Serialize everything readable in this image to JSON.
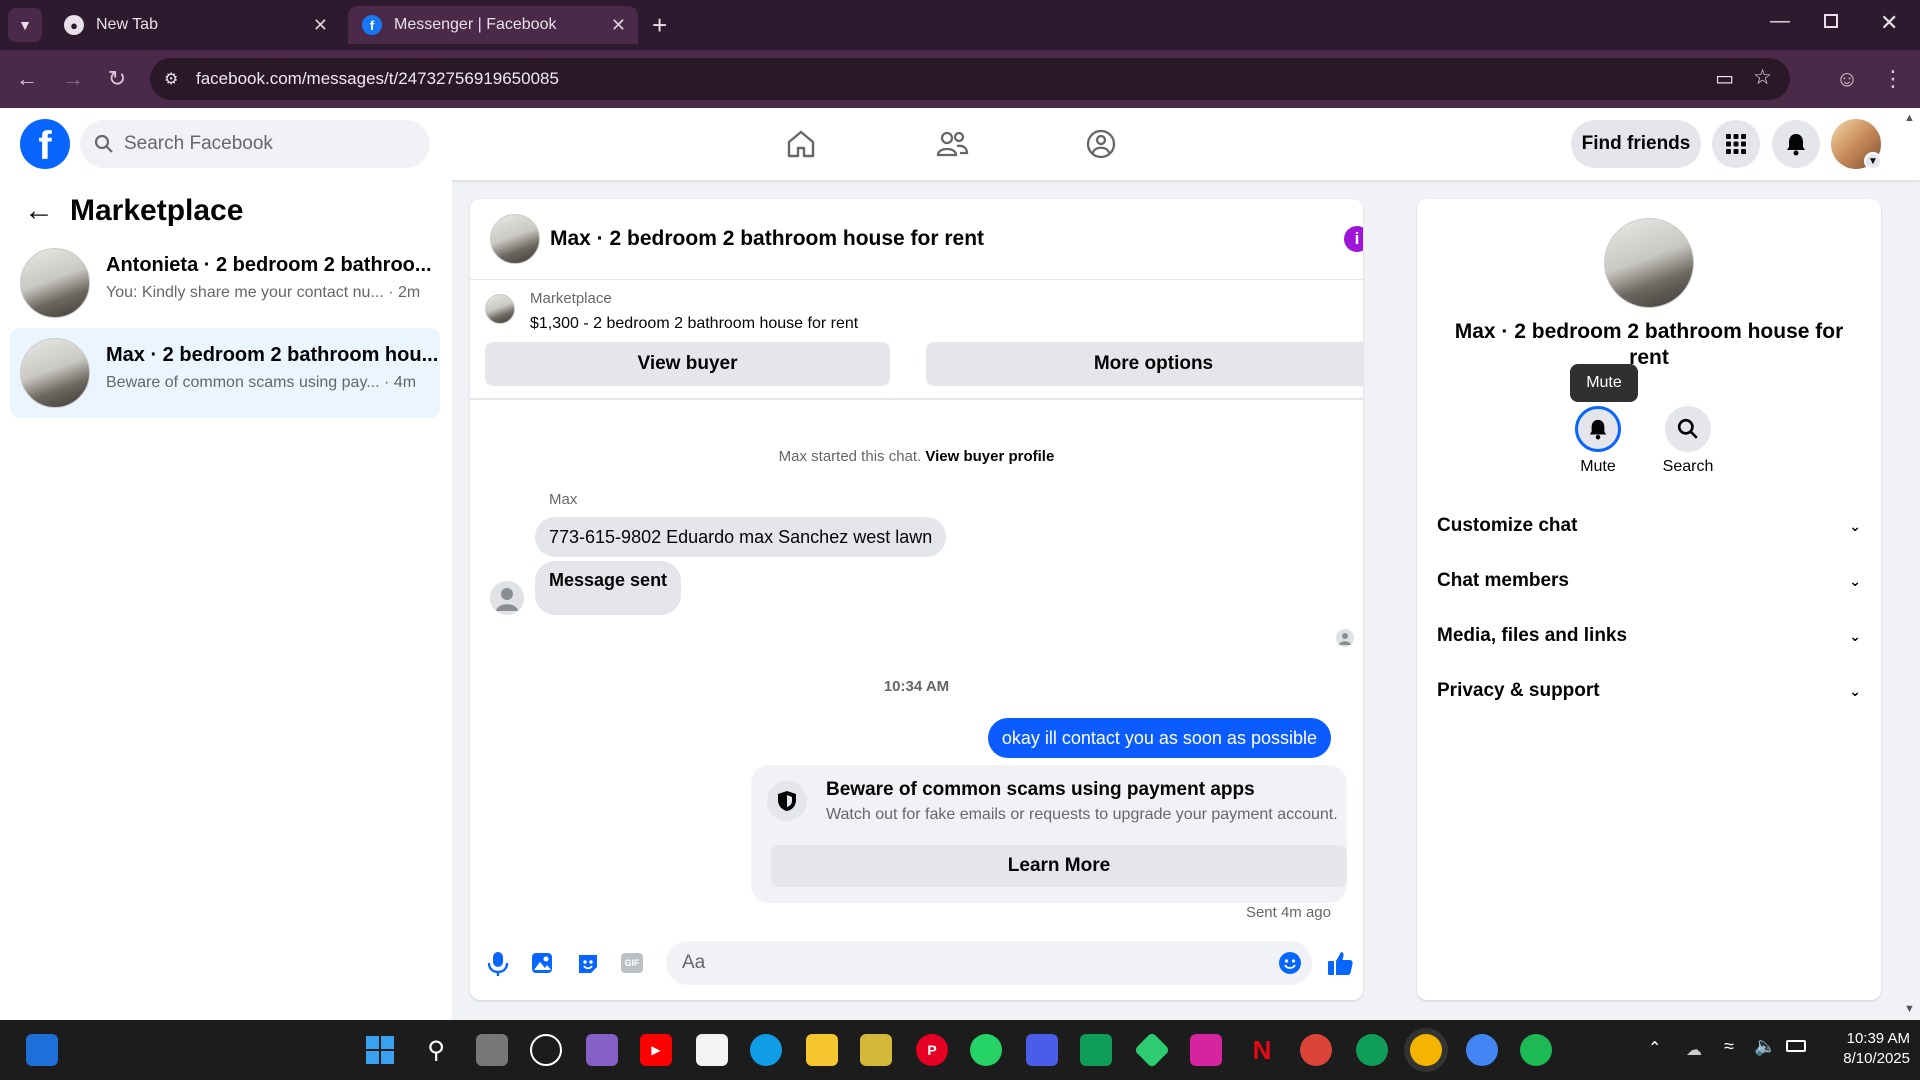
{
  "browser": {
    "tabs": [
      {
        "title": "New Tab",
        "active": false
      },
      {
        "title": "Messenger | Facebook",
        "active": true
      }
    ],
    "url": "facebook.com/messages/t/24732756919650085"
  },
  "header": {
    "search_placeholder": "Search Facebook",
    "find_friends": "Find friends"
  },
  "sidebar": {
    "title": "Marketplace",
    "conversations": [
      {
        "title": "Antonieta · 2 bedroom 2 bathroo...",
        "snippet": "You: Kindly share me your contact nu...",
        "time": "· 2m",
        "selected": false
      },
      {
        "title": "Max · 2 bedroom 2 bathroom hou...",
        "snippet": "Beware of common scams using pay...",
        "time": "· 4m",
        "selected": true
      }
    ]
  },
  "chat": {
    "title": "Max · 2 bedroom 2 bathroom house for rent",
    "listing": {
      "label": "Marketplace",
      "summary": "$1,300 - 2 bedroom 2 bathroom house for rent"
    },
    "view_buyer": "View buyer",
    "more_options": "More options",
    "started_text": "Max started this chat.",
    "view_buyer_profile": "View buyer profile",
    "sender_name": "Max",
    "messages": [
      {
        "text": "773-615-9802 Eduardo max Sanchez west lawn",
        "from": "other"
      },
      {
        "text": "Message sent",
        "from": "other"
      }
    ],
    "timestamp": "10:34 AM",
    "my_message": "okay ill contact you as soon as possible",
    "warning": {
      "title": "Beware of common scams using payment apps",
      "body": "Watch out for fake emails or requests to upgrade your payment account.",
      "button": "Learn More"
    },
    "sent_status": "Sent 4m ago",
    "composer_placeholder": "Aa"
  },
  "details": {
    "name": "Max · 2 bedroom 2 bathroom house for rent",
    "tooltip": "Mute",
    "mute_label": "Mute",
    "search_label": "Search",
    "sections": [
      "Customize chat",
      "Chat members",
      "Media, files and links",
      "Privacy & support"
    ]
  },
  "taskbar": {
    "time": "10:39 AM",
    "date": "8/10/2025"
  },
  "colors": {
    "facebook_blue": "#0866ff",
    "messenger_bubble": "#0a5cff",
    "info_purple": "#a016d8"
  }
}
